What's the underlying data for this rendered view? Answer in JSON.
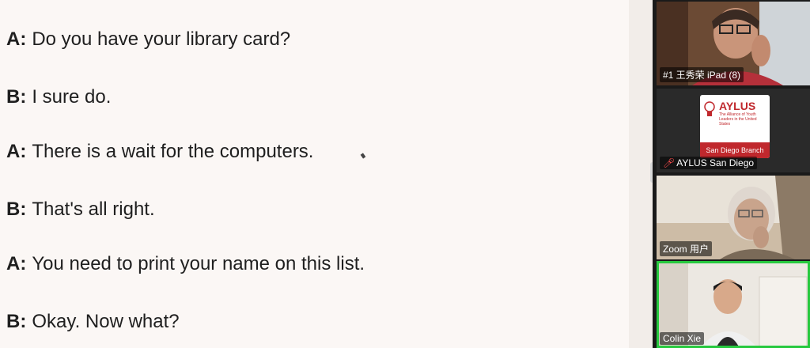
{
  "dialogue": [
    {
      "speaker": "A:",
      "text": "Do you have your library card?"
    },
    {
      "speaker": "B:",
      "text": "I sure do."
    },
    {
      "speaker": "A:",
      "text": "There is a wait for the computers."
    },
    {
      "speaker": "B:",
      "text": "That's all right."
    },
    {
      "speaker": "A:",
      "text": "You need to print your name on this list."
    },
    {
      "speaker": "B:",
      "text": "Okay. Now what?"
    }
  ],
  "participants": [
    {
      "name": "#1 王秀荣 iPad (8)",
      "muted": false,
      "active": false
    },
    {
      "name": "AYLUS San Diego",
      "muted": true,
      "active": false,
      "logo": {
        "title": "AYLUS",
        "subtitle": "The Alliance of Youth Leaders in the United States",
        "branch": "San Diego Branch"
      }
    },
    {
      "name": "Zoom 用户",
      "muted": false,
      "active": false
    },
    {
      "name": "Colin Xie",
      "muted": false,
      "active": true
    }
  ],
  "colors": {
    "accent_active": "#27c93f",
    "brand_red": "#c0282d"
  },
  "icons": {
    "muted": "mic-muted-icon"
  }
}
